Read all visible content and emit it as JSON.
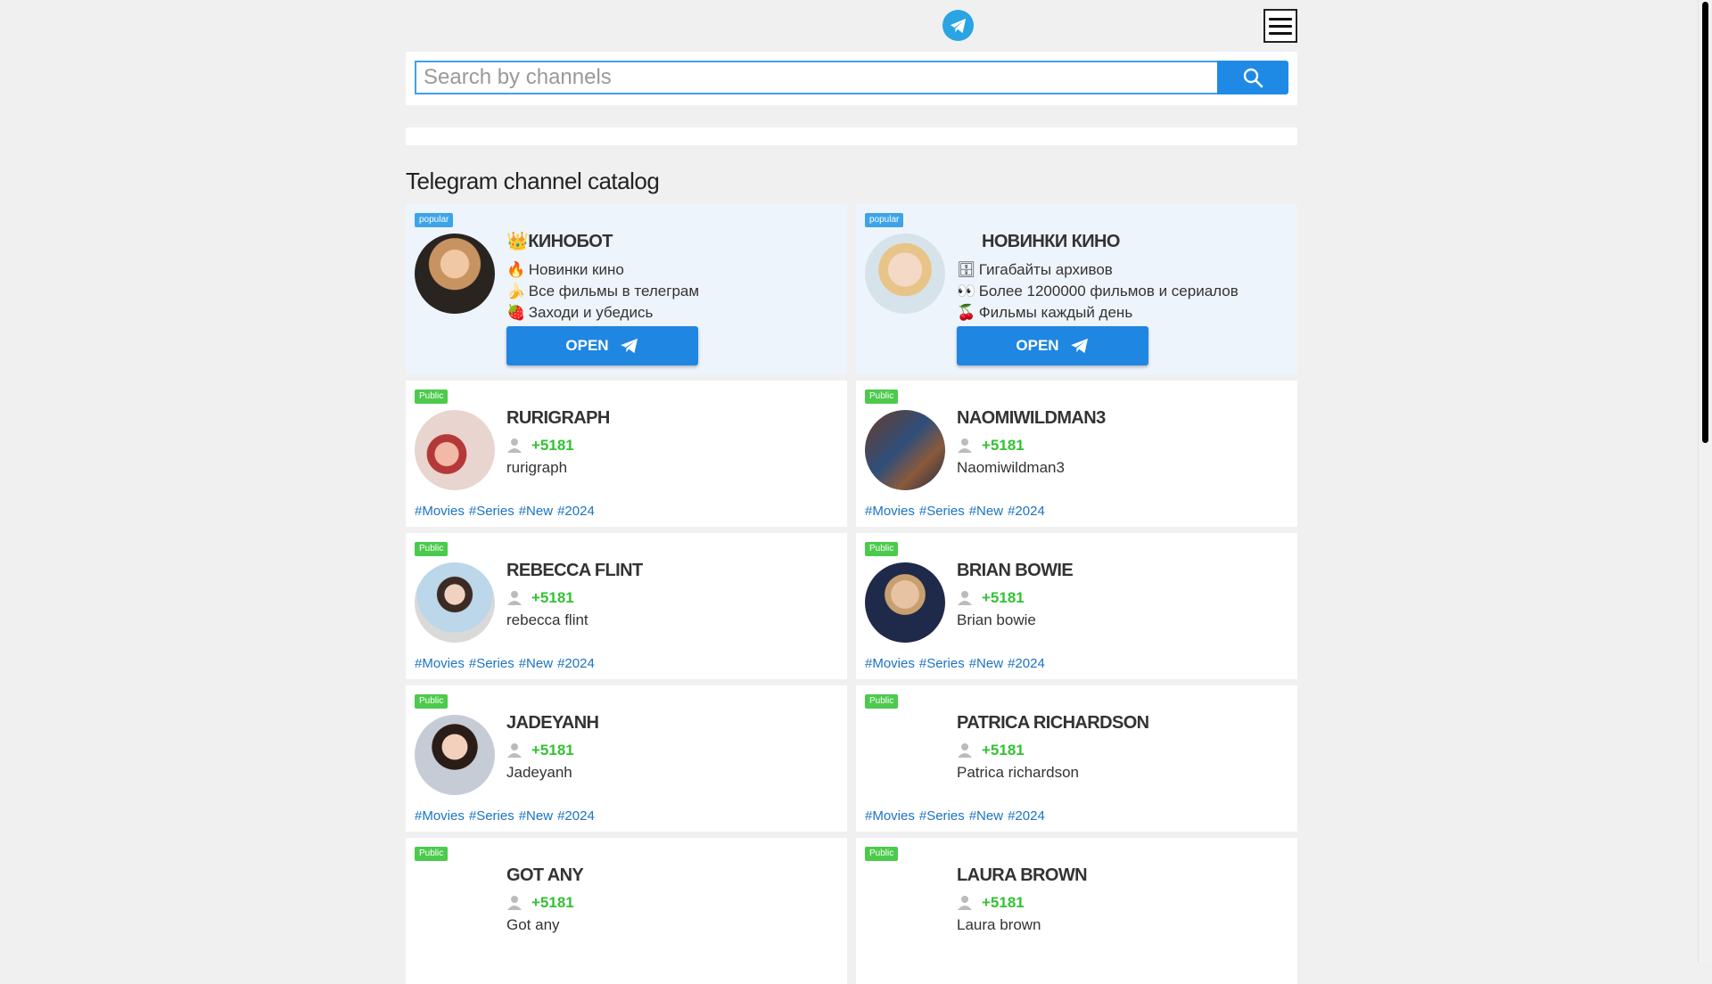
{
  "header": {
    "menu_icon": "hamburger-menu-icon",
    "logo_icon": "telegram-icon"
  },
  "search": {
    "placeholder": "Search by channels",
    "button_icon": "search-icon"
  },
  "page_title": "Telegram channel catalog",
  "colors": {
    "accent": "#1f86e2",
    "public_badge": "#4cca4c",
    "popular_badge": "#3ea4ea",
    "stat_green": "#33c233",
    "tag_blue": "#1a73c4"
  },
  "promo": [
    {
      "badge": "popular",
      "name": "👑КИНОБОТ",
      "lines": [
        {
          "emoji": "🔥",
          "text": "Новинки кино"
        },
        {
          "emoji": "🍌",
          "text": "Все фильмы в телеграм"
        },
        {
          "emoji": "🍓",
          "text": "Заходи и убедись"
        }
      ],
      "button": "OPEN"
    },
    {
      "badge": "popular",
      "name": "НОВИНКИ КИНО",
      "lines": [
        {
          "emoji": "🗄",
          "text": "Гигабайты архивов"
        },
        {
          "emoji": "👀",
          "text": "Более 1200000 фильмов и сериалов"
        },
        {
          "emoji": "🍒",
          "text": "Фильмы каждый день"
        }
      ],
      "button": "OPEN"
    }
  ],
  "channels": [
    {
      "badge": "Public",
      "name": "RURIGRAPH",
      "subs": "+5181",
      "desc": "rurigraph",
      "tags": [
        "#Movies",
        "#Series",
        "#New",
        "#2024"
      ]
    },
    {
      "badge": "Public",
      "name": "NAOMIWILDMAN3",
      "subs": "+5181",
      "desc": "Naomiwildman3",
      "tags": [
        "#Movies",
        "#Series",
        "#New",
        "#2024"
      ]
    },
    {
      "badge": "Public",
      "name": "REBECCA FLINT",
      "subs": "+5181",
      "desc": "rebecca flint",
      "tags": [
        "#Movies",
        "#Series",
        "#New",
        "#2024"
      ]
    },
    {
      "badge": "Public",
      "name": "BRIAN BOWIE",
      "subs": "+5181",
      "desc": "Brian bowie",
      "tags": [
        "#Movies",
        "#Series",
        "#New",
        "#2024"
      ]
    },
    {
      "badge": "Public",
      "name": "JADEYANH",
      "subs": "+5181",
      "desc": "Jadeyanh",
      "tags": [
        "#Movies",
        "#Series",
        "#New",
        "#2024"
      ]
    },
    {
      "badge": "Public",
      "name": "PATRICA RICHARDSON",
      "subs": "+5181",
      "desc": "Patrica richardson",
      "tags": [
        "#Movies",
        "#Series",
        "#New",
        "#2024"
      ]
    },
    {
      "badge": "Public",
      "name": "GOT ANY",
      "subs": "+5181",
      "desc": "Got any",
      "tags": []
    },
    {
      "badge": "Public",
      "name": "LAURA BROWN",
      "subs": "+5181",
      "desc": "Laura brown",
      "tags": []
    }
  ]
}
